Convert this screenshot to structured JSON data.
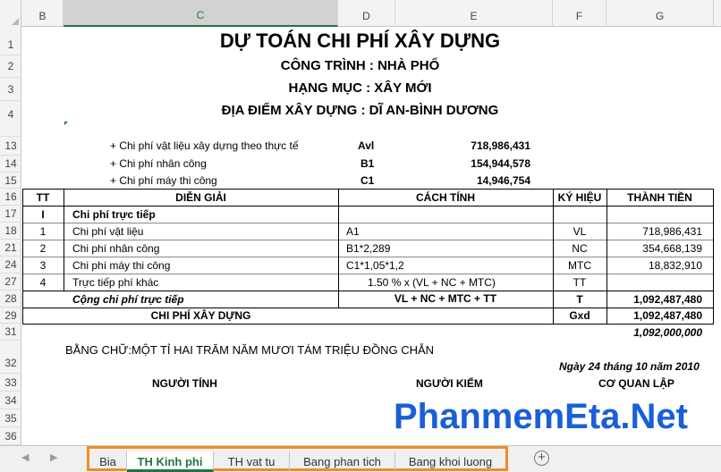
{
  "columns": [
    "B",
    "C",
    "D",
    "E",
    "F",
    "G"
  ],
  "rows": [
    "1",
    "2",
    "3",
    "4",
    "13",
    "14",
    "15",
    "16",
    "17",
    "18",
    "21",
    "24",
    "27",
    "28",
    "29",
    "31",
    "32",
    "33",
    "34",
    "35",
    "36"
  ],
  "header": {
    "title": "DỰ TOÁN CHI PHÍ XÂY DỰNG",
    "project": "CÔNG TRÌNH : NHÀ PHỐ",
    "item": "HẠNG MỤC : XÂY MỚI",
    "location": "ĐỊA ĐIỂM XÂY DỰNG : DĨ AN-BÌNH DƯƠNG"
  },
  "summary": [
    {
      "label": "+ Chi phí vật liệu xây dựng theo thực tế",
      "code": "Avl",
      "value": "718,986,431"
    },
    {
      "label": "+ Chi phí nhân công",
      "code": "B1",
      "value": "154,944,578"
    },
    {
      "label": "+ Chi phí máy thi công",
      "code": "C1",
      "value": "14,946,754"
    }
  ],
  "table": {
    "headers": {
      "tt": "TT",
      "desc": "DIỄN GIẢI",
      "calc": "CÁCH TÍNH",
      "code": "KÝ HIỆU",
      "amount": "THÀNH TIỀN"
    },
    "rows": [
      {
        "tt": "I",
        "desc": "Chi phí trực tiếp",
        "calc": "",
        "code": "",
        "amount": ""
      },
      {
        "tt": "1",
        "desc": "Chi phí vật liệu",
        "calc": "A1",
        "code": "VL",
        "amount": "718,986,431"
      },
      {
        "tt": "2",
        "desc": "Chi phí nhân công",
        "calc": "B1*2,289",
        "code": "NC",
        "amount": "354,668,139"
      },
      {
        "tt": "3",
        "desc": "Chi phí máy thi công",
        "calc": "C1*1,05*1,2",
        "code": "MTC",
        "amount": "18,832,910"
      },
      {
        "tt": "4",
        "desc": "Trực tiếp phí khác",
        "calc": "1.50  % x (VL + NC + MTC)",
        "code": "TT",
        "amount": ""
      },
      {
        "tt": "",
        "desc": "Cộng chi phí trực tiếp",
        "calc": "VL + NC + MTC + TT",
        "code": "T",
        "amount": "1,092,487,480"
      },
      {
        "tt": "",
        "desc": "CHI PHÍ XÂY DỰNG",
        "calc": "",
        "code": "Gxd",
        "amount": "1,092,487,480"
      }
    ]
  },
  "rounded_total": "1,092,000,000",
  "in_words": "BẰNG CHỮ:MỘT TỈ HAI TRĂM NĂM MƯƠI TÁM TRIỆU ĐỒNG CHẴN",
  "date": "Ngày 24 tháng 10 năm 2010",
  "signatures": {
    "calculator": "NGƯỜI TÍNH",
    "checker": "NGƯỜI KIỂM",
    "authority": "CƠ QUAN LẬP"
  },
  "watermark": "PhanmemEta.Net",
  "sheet_tabs": [
    "Bia",
    "TH Kinh phi",
    "TH vat tu",
    "Bang phan tich",
    "Bang khoi luong"
  ],
  "active_tab": "TH Kinh phi",
  "colors": {
    "accent": "#217346",
    "highlight": "#f08c28",
    "watermark": "#1a5fd6"
  }
}
